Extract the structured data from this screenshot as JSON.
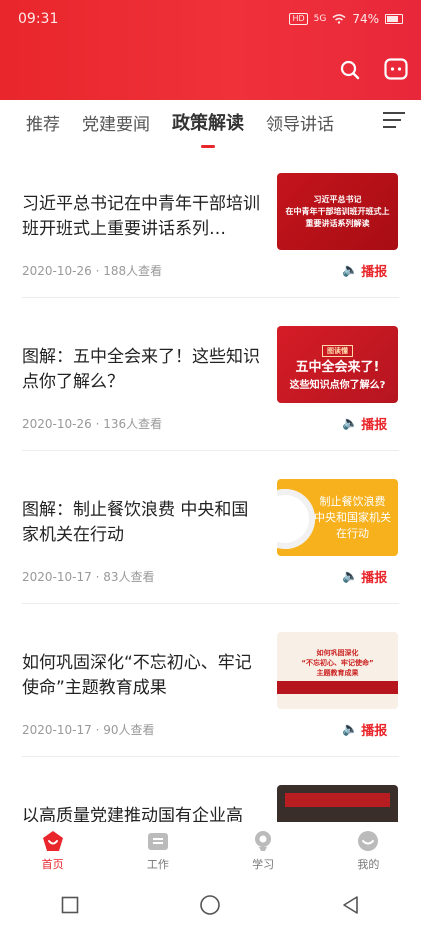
{
  "status_bar": {
    "time": "09:31",
    "hd": "HD",
    "signal": "5G",
    "battery": "74%"
  },
  "header": {
    "search_icon": "search-icon",
    "message_icon": "message-icon"
  },
  "tabs": [
    {
      "label": "推荐",
      "active": false
    },
    {
      "label": "党建要闻",
      "active": false
    },
    {
      "label": "政策解读",
      "active": true
    },
    {
      "label": "领导讲话",
      "active": false
    }
  ],
  "articles": [
    {
      "title": "习近平总书记在中青年干部培训班开班式上重要讲话系列…",
      "date": "2020-10-26",
      "views": "188人查看",
      "listen_label": "播报",
      "thumb": {
        "line1": "习近平总书记",
        "line2": "在中青年干部培训班开班式上",
        "line3": "重要讲话系列解读"
      }
    },
    {
      "title": "图解：五中全会来了！这些知识点你了解么？",
      "date": "2020-10-26",
      "views": "136人查看",
      "listen_label": "播报",
      "thumb": {
        "tag": "图读懂",
        "line1": "五中全会来了!",
        "line2": "这些知识点你了解么?"
      }
    },
    {
      "title": "图解：制止餐饮浪费 中央和国家机关在行动",
      "date": "2020-10-17",
      "views": "83人查看",
      "listen_label": "播报",
      "thumb": {
        "line1": "制止餐饮浪费",
        "line2": "中央和国家机关",
        "line3": "在行动"
      }
    },
    {
      "title": "如何巩固深化“不忘初心、牢记使命”主题教育成果",
      "date": "2020-10-17",
      "views": "90人查看",
      "listen_label": "播报",
      "thumb": {
        "line1": "如何巩固深化",
        "line2": "“不忘初心、牢记使命”",
        "line3": "主题教育成果"
      }
    },
    {
      "title": "以高质量党建推动国有企业高",
      "thumb": {}
    }
  ],
  "bottom_nav": [
    {
      "label": "首页",
      "icon": "home-icon",
      "active": true
    },
    {
      "label": "工作",
      "icon": "work-icon",
      "active": false
    },
    {
      "label": "学习",
      "icon": "study-icon",
      "active": false
    },
    {
      "label": "我的",
      "icon": "profile-icon",
      "active": false
    }
  ],
  "colors": {
    "brand": "#e8262b"
  }
}
